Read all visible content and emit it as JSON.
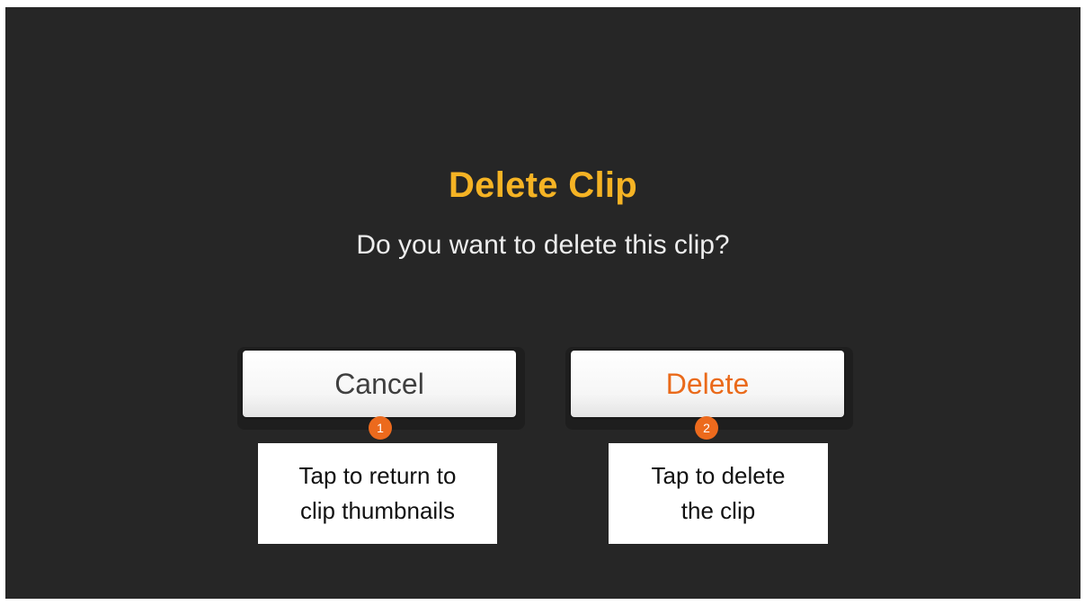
{
  "dialog": {
    "title": "Delete Clip",
    "message": "Do you want to delete this clip?",
    "cancel_label": "Cancel",
    "delete_label": "Delete"
  },
  "callouts": [
    {
      "number": "1",
      "line1": "Tap to return to",
      "line2": "clip thumbnails"
    },
    {
      "number": "2",
      "line1": "Tap to delete",
      "line2": "the clip"
    }
  ],
  "colors": {
    "background": "#262626",
    "title": "#f5b324",
    "delete_text": "#ea6a1a",
    "marker": "#ec6a1d"
  }
}
